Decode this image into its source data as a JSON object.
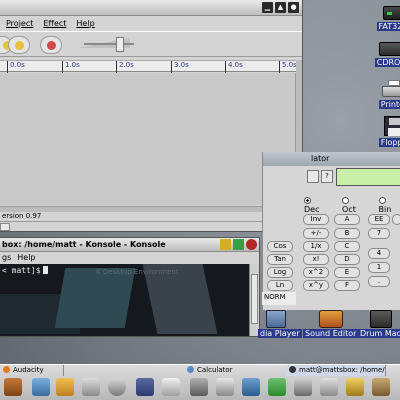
{
  "audacity": {
    "menu": [
      "Project",
      "Effect",
      "Help"
    ],
    "ruler_ticks": [
      "0.0s",
      "1.0s",
      "2.0s",
      "3.0s",
      "4.0s",
      "5.0s"
    ],
    "status": "ersion 0.97",
    "titlebar_buttons": [
      "min",
      "max",
      "close"
    ]
  },
  "desktop_icons": [
    {
      "label": "FAT32 F",
      "icon": "drive-icon"
    },
    {
      "label": "CDROM",
      "icon": "cdrom-icon"
    },
    {
      "label": "Printer",
      "icon": "printer-icon"
    },
    {
      "label": "Floppy",
      "icon": "floppy-icon"
    }
  ],
  "calculator": {
    "title": "lator",
    "small_buttons": [
      "?"
    ],
    "radio_labels": [
      "Dec",
      "Oct",
      "Bin"
    ],
    "radio_selected": "Dec",
    "left_buttons": [
      "Inv",
      "Cos",
      "Tan",
      "Log",
      "Ln"
    ],
    "mid_buttons": [
      "+/-",
      "1/x",
      "x!",
      "x^2",
      "x^y"
    ],
    "hex_buttons": [
      "A",
      "B",
      "C",
      "D",
      "E",
      "F"
    ],
    "right_buttons": [
      "EE",
      "7",
      "4",
      "1",
      "."
    ],
    "mode": "NORM"
  },
  "konsole": {
    "title": "box: /home/matt - Konsole - Konsole",
    "menu": [
      "gs",
      "Help"
    ],
    "prompt": "< matt]$",
    "watermark": "K Desktop Environment"
  },
  "apps": [
    {
      "label": "dia Player"
    },
    {
      "label": "Sound Editor"
    },
    {
      "label": "Drum Mac"
    }
  ],
  "taskbar": {
    "tasks": [
      "Audacity",
      "Calculator",
      "matt@mattsbox: /home/m"
    ]
  }
}
